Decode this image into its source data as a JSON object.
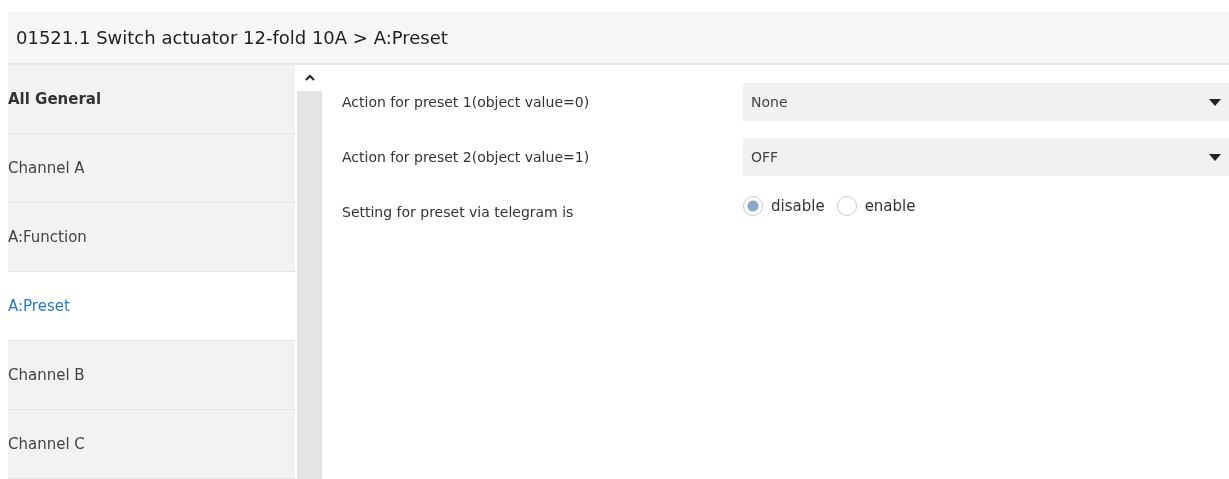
{
  "header": {
    "title": "01521.1 Switch actuator 12-fold 10A > A:Preset"
  },
  "sidebar": {
    "items": [
      {
        "label": "All General",
        "selected": false,
        "bold": true
      },
      {
        "label": "Channel A",
        "selected": false,
        "bold": false
      },
      {
        "label": "A:Function",
        "selected": false,
        "bold": false
      },
      {
        "label": "A:Preset",
        "selected": true,
        "bold": false
      },
      {
        "label": "Channel B",
        "selected": false,
        "bold": false
      },
      {
        "label": "Channel C",
        "selected": false,
        "bold": false
      }
    ]
  },
  "parameters": [
    {
      "kind": "dropdown",
      "label": "Action for preset 1(object value=0)",
      "value": "None"
    },
    {
      "kind": "dropdown",
      "label": "Action for preset 2(object value=1)",
      "value": "OFF"
    },
    {
      "kind": "radio",
      "label": "Setting for preset via telegram is",
      "options": [
        {
          "label": "disable",
          "selected": true
        },
        {
          "label": "enable",
          "selected": false
        }
      ]
    }
  ]
}
